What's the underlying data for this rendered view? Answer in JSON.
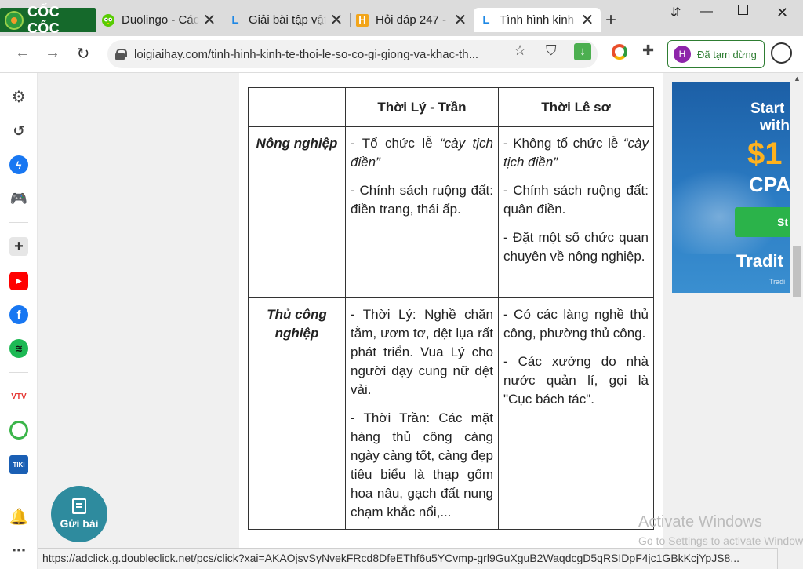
{
  "browser": {
    "brand": "CỐC CỐC",
    "tabs": [
      {
        "title": "Duolingo - Các",
        "favicon": "owl-icon",
        "active": false
      },
      {
        "title": "Giải bài tập vật",
        "favicon": "L-icon",
        "active": false
      },
      {
        "title": "Hỏi đáp 247 - C",
        "favicon": "H-icon",
        "active": false
      },
      {
        "title": "Tình hình kinh",
        "favicon": "L-icon",
        "active": true
      }
    ],
    "new_tab": "+",
    "url": "loigiaihay.com/tinh-hinh-kinh-te-thoi-le-so-co-gi-giong-va-khac-th...",
    "profile_initial": "H",
    "profile_label": "Đã tạm dừng"
  },
  "table": {
    "headers": [
      "",
      "Thời Lý - Trần",
      "Thời Lê sơ"
    ],
    "rows": [
      {
        "label": "Nông nghiệp",
        "col1": [
          {
            "pre": "- Tổ chức lễ ",
            "em": "“cày tịch điền”"
          },
          {
            "pre": "- Chính sách ruộng đất: điền trang, thái ấp.",
            "em": ""
          }
        ],
        "col2": [
          {
            "pre": "- Không tổ chức lễ ",
            "em": "“cày tịch điền”"
          },
          {
            "pre": "- Chính sách ruộng đất: quân điền.",
            "em": ""
          },
          {
            "pre": "- Đặt một số chức quan chuyên về nông nghiệp.",
            "em": ""
          }
        ]
      },
      {
        "label": "Thủ công nghiệp",
        "col1": [
          {
            "pre": "- Thời Lý: Nghề chăn tằm, ươm tơ, dệt lụa rất phát triển. Vua Lý cho người dạy cung nữ dệt vải.",
            "em": ""
          },
          {
            "pre": "- Thời Trần: Các mặt hàng thủ công càng ngày càng tốt, càng đẹp tiêu biểu là thạp gốm hoa nâu, gạch đất nung chạm khắc nổi,...",
            "em": ""
          }
        ],
        "col2": [
          {
            "pre": "- Có các làng nghề thủ công, phường thủ công.",
            "em": ""
          },
          {
            "pre": "- Các xưởng do nhà nước quản lí, gọi là \"Cục bách tác\".",
            "em": ""
          }
        ]
      }
    ]
  },
  "ad": {
    "line1": "Start",
    "line2": "with",
    "line3": "$1",
    "line4": "CPA",
    "button": "St",
    "line5": "Tradit",
    "line6": "Tradi"
  },
  "fab_label": "Gửi bài",
  "watermark": {
    "title": "Activate Windows",
    "subtitle": "Go to Settings to activate Windows."
  },
  "status_url": "https://adclick.g.doubleclick.net/pcs/click?xai=AKAOjsvSyNvekFRcd8DfeEThf6u5YCvmp-grl9GuXguB2WaqdcgD5qRSIDpF4jc1GBkKcjYpJS8..."
}
